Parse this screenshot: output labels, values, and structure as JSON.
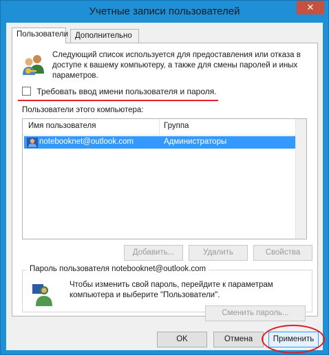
{
  "window": {
    "title": "Учетные записи пользователей",
    "close_glyph": "✕"
  },
  "tabs": [
    {
      "label": "Пользователи",
      "active": true
    },
    {
      "label": "Дополнительно",
      "active": false
    }
  ],
  "intro": {
    "text": "Следующий список используется для предоставления или отказа в доступе к вашему компьютеру, а также для смены паролей и иных параметров."
  },
  "checkbox": {
    "label": "Требовать ввод имени пользователя и пароля.",
    "checked": false
  },
  "users": {
    "caption": "Пользователи этого компьютера:",
    "columns": [
      "Имя пользователя",
      "Группа"
    ],
    "rows": [
      {
        "name": "notebooknet@outlook.com",
        "group": "Администраторы",
        "selected": true
      }
    ]
  },
  "user_buttons": {
    "add": "Добавить...",
    "remove": "Удалить",
    "properties": "Свойства"
  },
  "password": {
    "legend": "Пароль пользователя notebooknet@outlook.com",
    "text": "Чтобы изменить свой пароль, перейдите к параметрам компьютера и выберите \"Пользователи\".",
    "button": "Сменить пароль..."
  },
  "footer": {
    "ok": "OK",
    "cancel": "Отмена",
    "apply": "Применить"
  },
  "icons": {
    "users": "users-icon",
    "user": "user-icon",
    "password_user": "user-password-icon"
  },
  "colors": {
    "selection": "#3399ff",
    "annotation": "#e0212e",
    "titlebar": "#1f8fd6"
  }
}
